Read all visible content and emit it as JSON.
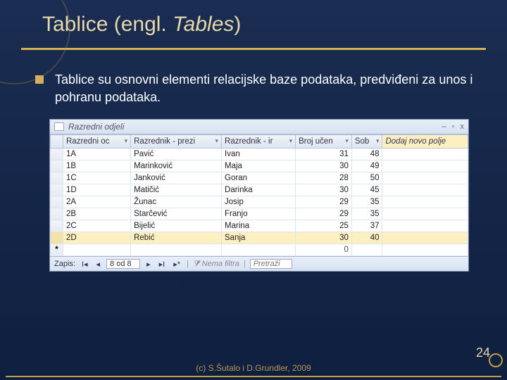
{
  "title": {
    "part1": "Tablice (engl. ",
    "part2": "Tables",
    "part3": ")"
  },
  "bullet": "Tablice su osnovni elementi relacijske baze podataka, predviđeni za unos i pohranu podataka.",
  "table": {
    "tab": "Razredni odjeli",
    "cols": [
      "Razredni oc",
      "Razrednik - prezi",
      "Razrednik - ir",
      "Broj učen",
      "Sob"
    ],
    "add_field": "Dodaj novo polje",
    "rows": [
      {
        "r": "1A",
        "prez": "Pavić",
        "ime": "Ivan",
        "broj": 31,
        "sob": 48
      },
      {
        "r": "1B",
        "prez": "Marinković",
        "ime": "Maja",
        "broj": 30,
        "sob": 49
      },
      {
        "r": "1C",
        "prez": "Janković",
        "ime": "Goran",
        "broj": 28,
        "sob": 50
      },
      {
        "r": "1D",
        "prez": "Matičić",
        "ime": "Darinka",
        "broj": 30,
        "sob": 45
      },
      {
        "r": "2A",
        "prez": "Žunac",
        "ime": "Josip",
        "broj": 29,
        "sob": 35
      },
      {
        "r": "2B",
        "prez": "Starčević",
        "ime": "Franjo",
        "broj": 29,
        "sob": 35
      },
      {
        "r": "2C",
        "prez": "Bijelić",
        "ime": "Marina",
        "broj": 25,
        "sob": 37
      },
      {
        "r": "2D",
        "prez": "Rebić",
        "ime": "Sanja",
        "broj": 30,
        "sob": 40,
        "selected": true
      }
    ],
    "newrow_broj": 0
  },
  "nav": {
    "label": "Zapis:",
    "pos": "8 od 8",
    "filter": "Nema filtra",
    "search": "Pretraži"
  },
  "footer": "(c) S.Šutalo i D.Grundler, 2009",
  "page": "24"
}
